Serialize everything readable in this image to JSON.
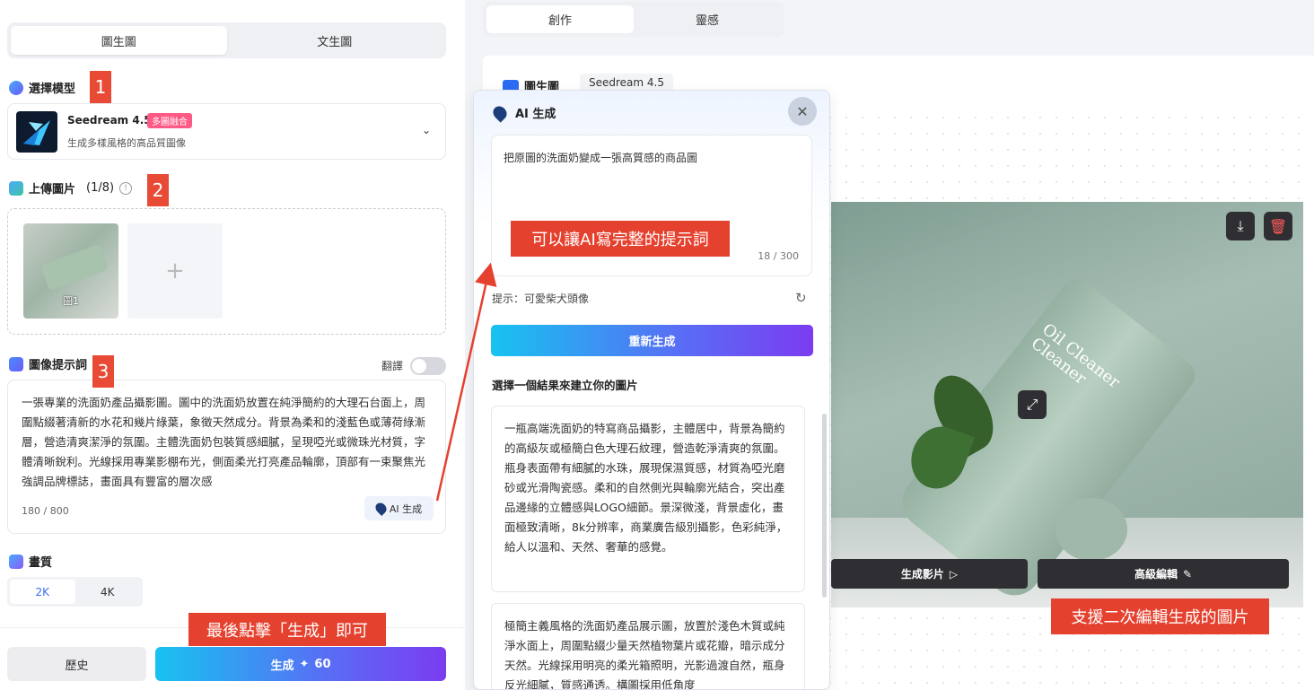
{
  "left": {
    "mode_tabs": [
      "圖生圖",
      "文生圖"
    ],
    "model_section": {
      "title": "選擇模型"
    },
    "model": {
      "name": "Seedream 4.5",
      "tag": "多圖融合",
      "desc": "生成多樣風格的高品質圖像"
    },
    "upload_section": {
      "title": "上傳圖片",
      "count": "(1/8)"
    },
    "thumbnail_label": "圖1",
    "add_symbol": "+",
    "prompt_section": {
      "title": "圖像提示詞",
      "translate": "翻譯"
    },
    "prompt_text": "一張專業的洗面奶產品攝影圖。圖中的洗面奶放置在純淨簡約的大理石台面上，周圍點綴著清新的水花和幾片綠葉，象徵天然成分。背景為柔和的淺藍色或薄荷綠漸層，營造清爽潔淨的氛圍。主體洗面奶包裝質感細膩，呈現啞光或微珠光材質，字體清晰銳利。光線採用專業影棚布光，側面柔光打亮產品輪廓，頂部有一束聚焦光強調品牌標誌，畫面具有豐富的層次感",
    "prompt_count": "180 / 800",
    "ai_button": "AI 生成",
    "quality_section": {
      "title": "畫質"
    },
    "quality_options": [
      "2K",
      "4K"
    ],
    "history_button": "歷史",
    "generate_button": {
      "label": "生成",
      "cost": "60"
    }
  },
  "annotations": {
    "n1": "1",
    "n2": "2",
    "n3": "3",
    "final": "最後點擊「生成」即可",
    "ai_hint": "可以讓AI寫完整的提示詞",
    "edit_hint": "支援二次編輯生成的圖片"
  },
  "top_tabs": [
    "創作",
    "靈感"
  ],
  "work_header": {
    "label": "圖生圖",
    "model_tag": "Seedream 4.5"
  },
  "result_image": {
    "product_text": "Oil Cleaner\nCleaner",
    "video_button": "生成影片",
    "edit_button": "高級編輯"
  },
  "popup": {
    "title": "AI 生成",
    "input_text": "把原圖的洗面奶變成一張高質感的商品圖",
    "input_count": "18 / 300",
    "hint": "提示：可愛柴犬頭像",
    "regen_button": "重新生成",
    "subtitle": "選擇一個結果來建立你的圖片",
    "results": [
      "一瓶高端洗面奶的特寫商品攝影，主體居中，背景為簡約的高級灰或極簡白色大理石紋理，營造乾淨清爽的氛圍。瓶身表面帶有細膩的水珠，展現保濕質感，材質為啞光磨砂或光滑陶瓷感。柔和的自然側光與輪廓光結合，突出產品邊緣的立體感與LOGO細節。景深微淺，背景虛化，畫面極致清晰，8k分辨率，商業廣告級別攝影，色彩純淨，給人以溫和、天然、奢華的感覺。",
      "極簡主義風格的洗面奶產品展示圖，放置於淺色木質或純淨水面上，周圍點綴少量天然植物葉片或花瓣，暗示成分天然。光線採用明亮的柔光箱照明，光影過渡自然，瓶身反光細膩，質感通透。構圖採用低角度"
    ]
  },
  "colors": {
    "accent": "#3b6df5",
    "annotation": "#e5412f",
    "tag_pink": "#ff5a86"
  }
}
